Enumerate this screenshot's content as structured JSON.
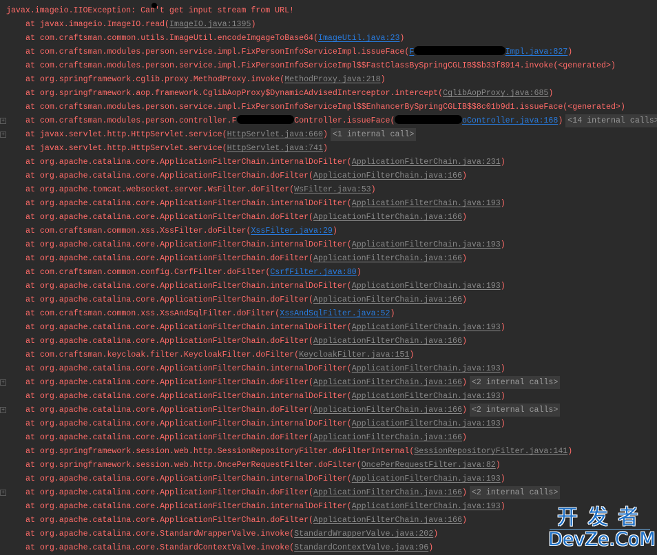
{
  "header": "javax.imageio.IIOException: Can't get input stream from URL!",
  "prefix": "at ",
  "lines": [
    {
      "m": "javax.imageio.ImageIO.read(",
      "f": "ImageIO.java:1395",
      "t": "gray"
    },
    {
      "m": "com.craftsman.common.utils.ImageUtil.encodeImgageToBase64(",
      "f": "ImageUtil.java:23",
      "t": "blue"
    },
    {
      "m": "com.craftsman.modules.person.service.impl.FixPersonInfoServiceImpl.issueFace(",
      "f": "Impl.java:827",
      "f_pre": "F",
      "t": "blue",
      "f_redacted": true
    },
    {
      "m": "com.craftsman.modules.person.service.impl.FixPersonInfoServiceImpl$$FastClassBySpringCGLIB$$b33f8914.invoke(<generated>",
      "t": "none"
    },
    {
      "m": "org.springframework.cglib.proxy.MethodProxy.invoke(",
      "f": "MethodProxy.java:218",
      "t": "gray"
    },
    {
      "m": "org.springframework.aop.framework.CglibAopProxy$DynamicAdvisedInterceptor.intercept(",
      "f": "CglibAopProxy.java:685",
      "t": "gray"
    },
    {
      "m": "com.craftsman.modules.person.service.impl.FixPersonInfoServiceImpl$$EnhancerBySpringCGLIB$$8c01b9d1.issueFace(<generated>",
      "t": "none"
    },
    {
      "m": "com.craftsman.modules.person.controller.F",
      "m_redacted": true,
      "m2": "Controller.issueFace(",
      "f": "oController.java:168",
      "t": "blue",
      "f_redacted": true,
      "badge": "<14 internal calls>",
      "fold": true
    },
    {
      "m": "javax.servlet.http.HttpServlet.service(",
      "f": "HttpServlet.java:660",
      "t": "gray",
      "badge": "<1 internal call>",
      "fold": true
    },
    {
      "m": "javax.servlet.http.HttpServlet.service(",
      "f": "HttpServlet.java:741",
      "t": "gray"
    },
    {
      "m": "org.apache.catalina.core.ApplicationFilterChain.internalDoFilter(",
      "f": "ApplicationFilterChain.java:231",
      "t": "gray"
    },
    {
      "m": "org.apache.catalina.core.ApplicationFilterChain.doFilter(",
      "f": "ApplicationFilterChain.java:166",
      "t": "gray"
    },
    {
      "m": "org.apache.tomcat.websocket.server.WsFilter.doFilter(",
      "f": "WsFilter.java:53",
      "t": "gray"
    },
    {
      "m": "org.apache.catalina.core.ApplicationFilterChain.internalDoFilter(",
      "f": "ApplicationFilterChain.java:193",
      "t": "gray"
    },
    {
      "m": "org.apache.catalina.core.ApplicationFilterChain.doFilter(",
      "f": "ApplicationFilterChain.java:166",
      "t": "gray"
    },
    {
      "m": "com.craftsman.common.xss.XssFilter.doFilter(",
      "f": "XssFilter.java:29",
      "t": "blue"
    },
    {
      "m": "org.apache.catalina.core.ApplicationFilterChain.internalDoFilter(",
      "f": "ApplicationFilterChain.java:193",
      "t": "gray"
    },
    {
      "m": "org.apache.catalina.core.ApplicationFilterChain.doFilter(",
      "f": "ApplicationFilterChain.java:166",
      "t": "gray"
    },
    {
      "m": "com.craftsman.common.config.CsrfFilter.doFilter(",
      "f": "CsrfFilter.java:80",
      "t": "blue"
    },
    {
      "m": "org.apache.catalina.core.ApplicationFilterChain.internalDoFilter(",
      "f": "ApplicationFilterChain.java:193",
      "t": "gray"
    },
    {
      "m": "org.apache.catalina.core.ApplicationFilterChain.doFilter(",
      "f": "ApplicationFilterChain.java:166",
      "t": "gray"
    },
    {
      "m": "com.craftsman.common.xss.XssAndSqlFilter.doFilter(",
      "f": "XssAndSqlFilter.java:52",
      "t": "blue"
    },
    {
      "m": "org.apache.catalina.core.ApplicationFilterChain.internalDoFilter(",
      "f": "ApplicationFilterChain.java:193",
      "t": "gray"
    },
    {
      "m": "org.apache.catalina.core.ApplicationFilterChain.doFilter(",
      "f": "ApplicationFilterChain.java:166",
      "t": "gray"
    },
    {
      "m": "com.craftsman.keycloak.filter.KeycloakFilter.doFilter(",
      "f": "KeycloakFilter.java:151",
      "t": "gray"
    },
    {
      "m": "org.apache.catalina.core.ApplicationFilterChain.internalDoFilter(",
      "f": "ApplicationFilterChain.java:193",
      "t": "gray"
    },
    {
      "m": "org.apache.catalina.core.ApplicationFilterChain.doFilter(",
      "f": "ApplicationFilterChain.java:166",
      "t": "gray",
      "badge": "<2 internal calls>",
      "fold": true
    },
    {
      "m": "org.apache.catalina.core.ApplicationFilterChain.internalDoFilter(",
      "f": "ApplicationFilterChain.java:193",
      "t": "gray"
    },
    {
      "m": "org.apache.catalina.core.ApplicationFilterChain.doFilter(",
      "f": "ApplicationFilterChain.java:166",
      "t": "gray",
      "badge": "<2 internal calls>",
      "fold": true
    },
    {
      "m": "org.apache.catalina.core.ApplicationFilterChain.internalDoFilter(",
      "f": "ApplicationFilterChain.java:193",
      "t": "gray"
    },
    {
      "m": "org.apache.catalina.core.ApplicationFilterChain.doFilter(",
      "f": "ApplicationFilterChain.java:166",
      "t": "gray"
    },
    {
      "m": "org.springframework.session.web.http.SessionRepositoryFilter.doFilterInternal(",
      "f": "SessionRepositoryFilter.java:141",
      "t": "gray"
    },
    {
      "m": "org.springframework.session.web.http.OncePerRequestFilter.doFilter(",
      "f": "OncePerRequestFilter.java:82",
      "t": "gray"
    },
    {
      "m": "org.apache.catalina.core.ApplicationFilterChain.internalDoFilter(",
      "f": "ApplicationFilterChain.java:193",
      "t": "gray"
    },
    {
      "m": "org.apache.catalina.core.ApplicationFilterChain.doFilter(",
      "f": "ApplicationFilterChain.java:166",
      "t": "gray",
      "badge": "<2 internal calls>",
      "fold": true
    },
    {
      "m": "org.apache.catalina.core.ApplicationFilterChain.internalDoFilter(",
      "f": "ApplicationFilterChain.java:193",
      "t": "gray"
    },
    {
      "m": "org.apache.catalina.core.ApplicationFilterChain.doFilter(",
      "f": "ApplicationFilterChain.java:166",
      "t": "gray"
    },
    {
      "m": "org.apache.catalina.core.StandardWrapperValve.invoke(",
      "f": "StandardWrapperValve.java:202",
      "t": "gray"
    },
    {
      "m": "org.apache.catalina.core.StandardContextValve.invoke(",
      "f": "StandardContextValve.java:96",
      "t": "gray"
    }
  ],
  "close_paren": ")",
  "fold_glyph": "+",
  "colors": {
    "background": "#2b2b2b",
    "error_text": "#ff6b68",
    "link_gray": "#888888",
    "link_blue": "#287bde",
    "badge_bg": "#3b3b3b"
  },
  "watermark": {
    "cn": "开发者",
    "en": "DevZe.CoM"
  }
}
